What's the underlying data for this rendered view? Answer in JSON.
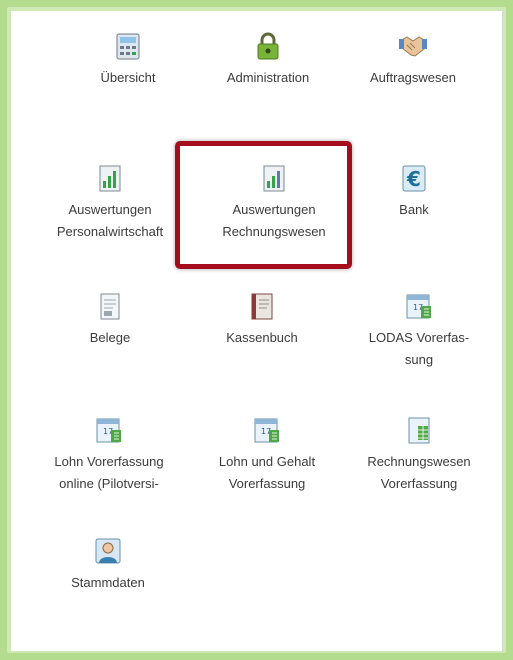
{
  "tiles": [
    {
      "id": "uebersicht",
      "label": "Übersicht",
      "icon": "calculator-icon"
    },
    {
      "id": "administration",
      "label": "Administration",
      "icon": "lock-icon"
    },
    {
      "id": "auftragswesen",
      "label": "Auftragswesen",
      "icon": "handshake-icon"
    },
    {
      "id": "auswertungen-personalwirtschaft",
      "label": "Auswertungen\nPersonalwirtschaft",
      "icon": "report-chart-icon"
    },
    {
      "id": "auswertungen-rechnungswesen",
      "label": "Auswertungen\nRechnungswesen",
      "icon": "report-chart-icon"
    },
    {
      "id": "bank",
      "label": "Bank",
      "icon": "euro-icon"
    },
    {
      "id": "belege",
      "label": "Belege",
      "icon": "document-icon"
    },
    {
      "id": "kassenbuch",
      "label": "Kassenbuch",
      "icon": "book-icon"
    },
    {
      "id": "lodas-vorerfassung",
      "label": "LODAS Vorerfas-\nsung",
      "icon": "calendar-entry-icon"
    },
    {
      "id": "lohn-vorerfassung-online",
      "label": "Lohn Vorerfassung\nonline (Pilotversi-",
      "icon": "calendar-entry-icon"
    },
    {
      "id": "lohn-und-gehalt-vorerfassung",
      "label": "Lohn und Gehalt\nVorerfassung",
      "icon": "calendar-entry-icon"
    },
    {
      "id": "rechnungswesen-vorerfassung",
      "label": "Rechnungswesen\nVorerfassung",
      "icon": "ledger-icon"
    },
    {
      "id": "stammdaten",
      "label": "Stammdaten",
      "icon": "person-icon"
    }
  ],
  "highlighted_tile": "auswertungen-rechnungswesen",
  "colors": {
    "frame": "#b3dc8f",
    "highlight_border": "#a50d1c",
    "text": "#3c3c3c"
  }
}
